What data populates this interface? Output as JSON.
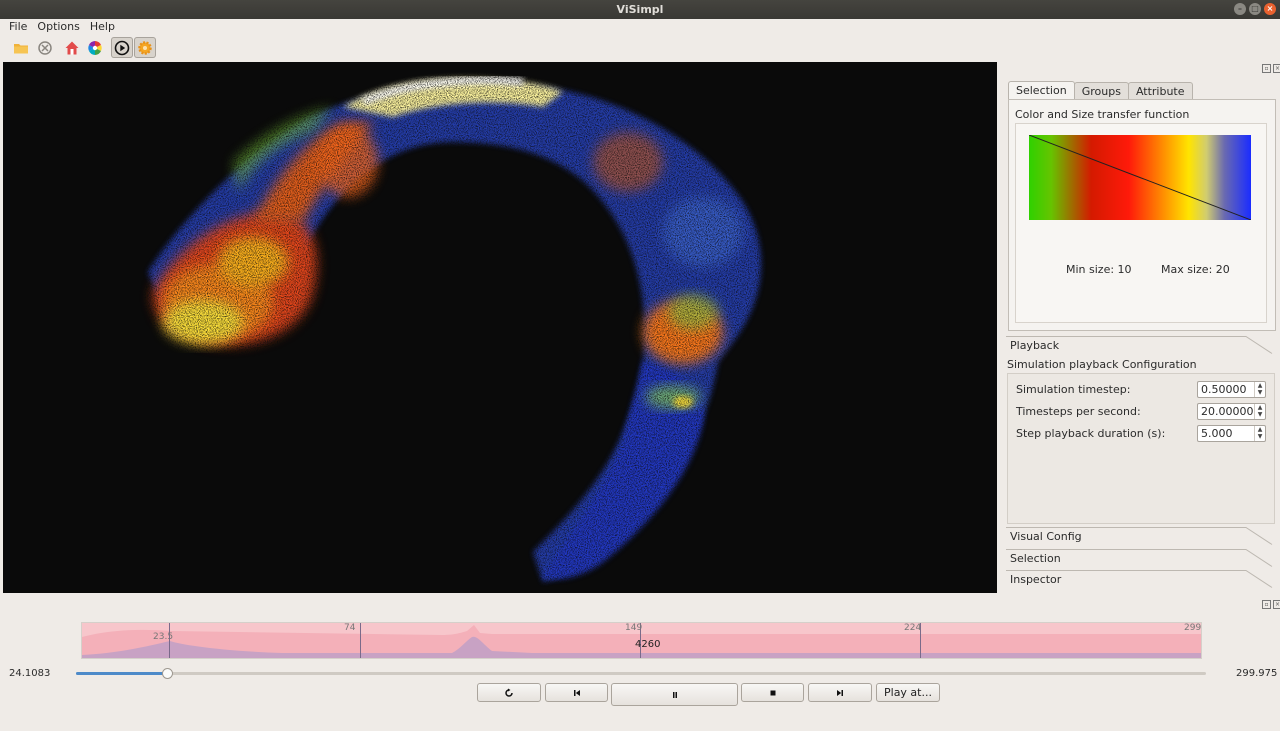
{
  "window": {
    "title": "ViSimpl"
  },
  "menu": {
    "items": [
      "File",
      "Options",
      "Help"
    ]
  },
  "toolbar": {
    "icons": [
      "open-folder-icon",
      "close-data-icon",
      "home-camera-icon",
      "color-palette-icon",
      "playback-play-icon",
      "settings-cog-icon"
    ]
  },
  "right_panel": {
    "tabs": [
      "Selection",
      "Groups",
      "Attribute"
    ],
    "active_tab": "Selection",
    "transfer_function": {
      "title": "Color and Size transfer function",
      "min_size": "Min size: 10",
      "max_size": "Max size: 20",
      "gradient_colors": [
        "#2fd100",
        "#d41a00",
        "#ff1a0a",
        "#ff9a00",
        "#ffe400",
        "#6a6ab0",
        "#1a2cff"
      ]
    },
    "playback": {
      "header": "Playback",
      "title": "Simulation playback Configuration",
      "fields": [
        {
          "label": "Simulation timestep:",
          "value": "0.50000"
        },
        {
          "label": "Timesteps per second:",
          "value": "20.00000"
        },
        {
          "label": "Step playback duration (s):",
          "value": "5.000"
        }
      ]
    },
    "sections": [
      "Visual Config",
      "Selection",
      "Inspector"
    ]
  },
  "timeline": {
    "tick_labels": [
      "23.5",
      "74",
      "149",
      "224",
      "299"
    ],
    "marker_value": "4260",
    "fill_color": "#f7c6cb"
  },
  "playback_controls": {
    "current_time": "24.1083",
    "end_time": "299.975",
    "progress_fraction": 0.08,
    "play_at_label": "Play at..."
  }
}
